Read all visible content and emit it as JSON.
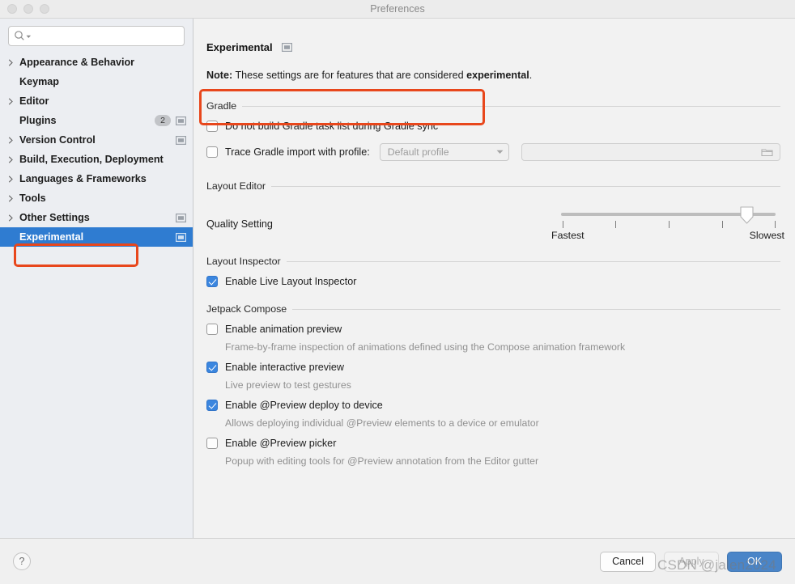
{
  "window": {
    "title": "Preferences",
    "traffic_lights": [
      "close",
      "minimize",
      "zoom"
    ]
  },
  "sidebar": {
    "search": {
      "value": "",
      "placeholder": ""
    },
    "items": [
      {
        "label": "Appearance & Behavior",
        "expandable": true,
        "selected": false,
        "badge": "",
        "panel_icon": false
      },
      {
        "label": "Keymap",
        "expandable": false,
        "selected": false,
        "badge": "",
        "panel_icon": false
      },
      {
        "label": "Editor",
        "expandable": true,
        "selected": false,
        "badge": "",
        "panel_icon": false
      },
      {
        "label": "Plugins",
        "expandable": false,
        "selected": false,
        "badge": "2",
        "panel_icon": true
      },
      {
        "label": "Version Control",
        "expandable": true,
        "selected": false,
        "badge": "",
        "panel_icon": true
      },
      {
        "label": "Build, Execution, Deployment",
        "expandable": true,
        "selected": false,
        "badge": "",
        "panel_icon": false
      },
      {
        "label": "Languages & Frameworks",
        "expandable": true,
        "selected": false,
        "badge": "",
        "panel_icon": false
      },
      {
        "label": "Tools",
        "expandable": true,
        "selected": false,
        "badge": "",
        "panel_icon": false
      },
      {
        "label": "Other Settings",
        "expandable": true,
        "selected": false,
        "badge": "",
        "panel_icon": true
      },
      {
        "label": "Experimental",
        "expandable": false,
        "selected": true,
        "badge": "",
        "panel_icon": true
      }
    ]
  },
  "content": {
    "page_title": "Experimental",
    "note_prefix": "Note:",
    "note_text": " These settings are for features that are considered ",
    "note_bold": "experimental",
    "note_suffix": ".",
    "gradle": {
      "group_label": "Gradle",
      "do_not_build": {
        "label": "Do not build Gradle task list during Gradle sync",
        "checked": false
      },
      "trace": {
        "label": "Trace Gradle import with profile:",
        "checked": false,
        "profile_value": "Default profile",
        "path_value": ""
      }
    },
    "layout_editor": {
      "group_label": "Layout Editor",
      "quality_label": "Quality Setting",
      "slider": {
        "min_label": "Fastest",
        "max_label": "Slowest",
        "ticks": 5,
        "value": 4,
        "max": 5
      }
    },
    "layout_inspector": {
      "group_label": "Layout Inspector",
      "enable_live": {
        "label": "Enable Live Layout Inspector",
        "checked": true
      }
    },
    "jetpack_compose": {
      "group_label": "Jetpack Compose",
      "options": [
        {
          "label": "Enable animation preview",
          "checked": false,
          "desc": "Frame-by-frame inspection of animations defined using the Compose animation framework"
        },
        {
          "label": "Enable interactive preview",
          "checked": true,
          "desc": "Live preview to test gestures"
        },
        {
          "label": "Enable @Preview deploy to device",
          "checked": true,
          "desc": "Allows deploying individual @Preview elements to a device or emulator"
        },
        {
          "label": "Enable @Preview picker",
          "checked": false,
          "desc": "Popup with editing tools for @Preview annotation from the Editor gutter"
        }
      ]
    }
  },
  "footer": {
    "help_label": "?",
    "cancel_label": "Cancel",
    "apply_label": "Apply",
    "ok_label": "OK"
  },
  "watermark": {
    "text": "CSDN @jalen2024"
  },
  "colors": {
    "selection_blue": "#2f7cd1",
    "annotation_red": "#e8471c",
    "checkbox_blue": "#3b86df",
    "primary_button": "#4a85c8",
    "sidebar_bg": "#eceef2",
    "content_bg": "#f2f2f2"
  }
}
